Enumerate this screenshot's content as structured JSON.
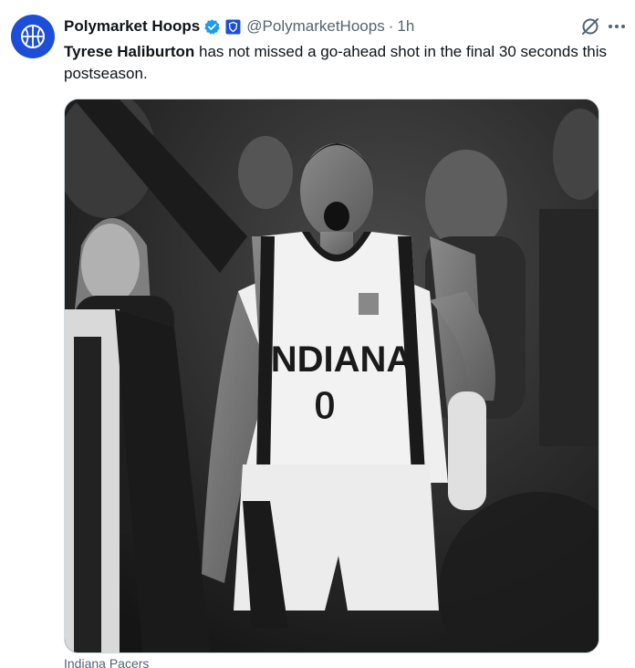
{
  "author": {
    "display_name": "Polymarket Hoops",
    "handle": "@PolymarketHoops",
    "separator": "·",
    "time": "1h",
    "avatar_icon": "basketball-icon",
    "verified_icon": "verified-badge-icon",
    "affiliate_icon": "affiliate-badge-icon",
    "brand_color": "#1d4ed8",
    "verified_color": "#1d9bf0"
  },
  "actions": {
    "grok_icon": "grok-icon",
    "more_icon": "more-icon"
  },
  "tweet": {
    "mention": "Tyrese Haliburton",
    "text": " has not missed a go-ahead shot in the final 30 seconds this postseason."
  },
  "media": {
    "jersey_text": "INDIANA",
    "jersey_number": "0",
    "caption": "Indiana Pacers"
  }
}
